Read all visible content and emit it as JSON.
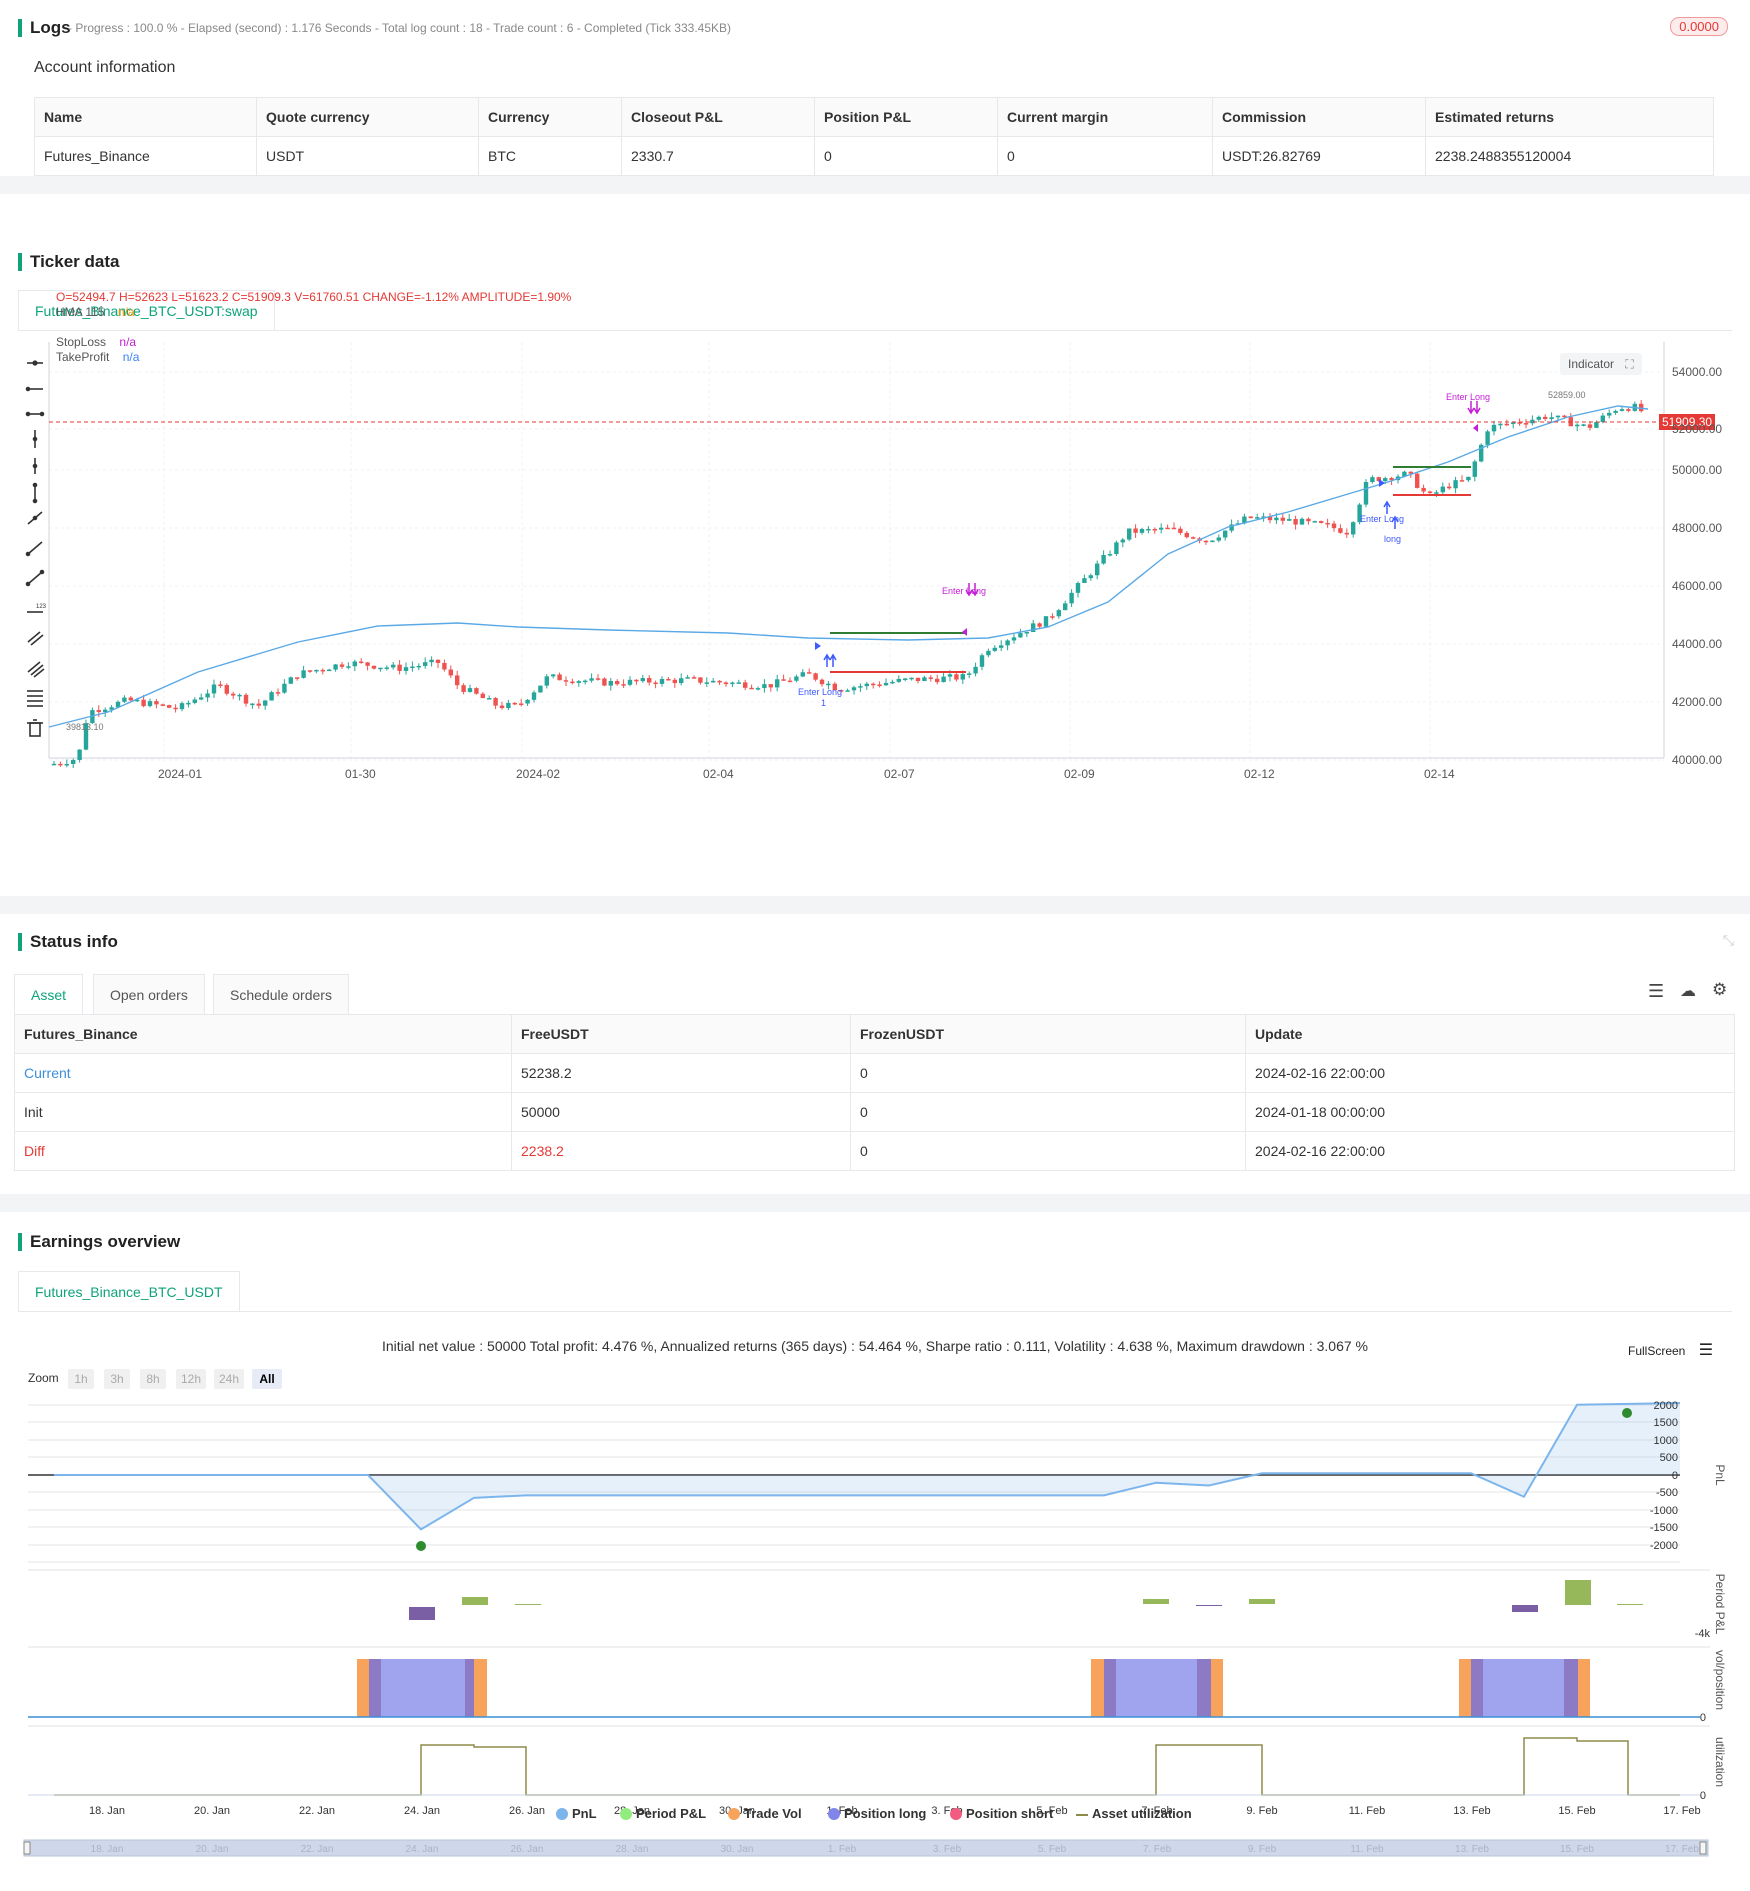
{
  "logs": {
    "title": "Logs",
    "progress_text": "- Progress : 100.0 % - Elapsed (second) : 1.176  Seconds - Total log count : 18 - Trade count : 6 - Completed (Tick 333.45KB)",
    "badge": "0.0000"
  },
  "account": {
    "title": "Account information",
    "headers": [
      "Name",
      "Quote currency",
      "Currency",
      "Closeout P&L",
      "Position P&L",
      "Current margin",
      "Commission",
      "Estimated returns"
    ],
    "row": [
      "Futures_Binance",
      "USDT",
      "BTC",
      "2330.7",
      "0",
      "0",
      "USDT:26.82769",
      "2238.2488355120004"
    ]
  },
  "ticker": {
    "title": "Ticker data",
    "tab": "Futures_Binance_BTC_USDT:swap",
    "ohlc_label": "O=52494.7 H=52623 L=51623.2 C=51909.3 V=61760.51 CHANGE=-1.12% AMPLITUDE=1.90%",
    "hma_label": "HMA 115",
    "hma_value": "n/a",
    "stoploss_label": "StopLoss",
    "stoploss_value": "n/a",
    "takeprofit_label": "TakeProfit",
    "takeprofit_value": "n/a",
    "indicator_button": "Indicator",
    "last_price": "51909.30",
    "high_label": "52859.00",
    "low_label": "39813.10",
    "enter_long_1": "Enter Long",
    "enter_long_2": "Enter Long",
    "enter_long_3": "Enter Long",
    "exit_1": "Enter Long",
    "exit_2": "Enter Long",
    "long_label": "long",
    "one_label": "1",
    "y_ticks": [
      "54000.00",
      "52000.00",
      "50000.00",
      "48000.00",
      "46000.00",
      "44000.00",
      "42000.00",
      "40000.00"
    ],
    "x_ticks": [
      "2024-01",
      "01-30",
      "2024-02",
      "02-04",
      "02-07",
      "02-09",
      "02-12",
      "02-14"
    ],
    "colors": {
      "up": "#26a69a",
      "down": "#ef5350",
      "hma": "#5aa9e6",
      "tp": "#2e7d32",
      "sl": "#e53935"
    }
  },
  "status": {
    "title": "Status info",
    "tabs": [
      "Asset",
      "Open orders",
      "Schedule orders"
    ],
    "headers": [
      "Futures_Binance",
      "FreeUSDT",
      "FrozenUSDT",
      "Update"
    ],
    "rows": [
      [
        "Current",
        "52238.2",
        "0",
        "2024-02-16 22:00:00"
      ],
      [
        "Init",
        "50000",
        "0",
        "2024-01-18 00:00:00"
      ],
      [
        "Diff",
        "2238.2",
        "0",
        "2024-02-16 22:00:00"
      ]
    ]
  },
  "earnings": {
    "title": "Earnings overview",
    "tab": "Futures_Binance_BTC_USDT",
    "summary": "Initial net value : 50000 Total profit: 4.476 %, Annualized returns (365 days) : 54.464 %, Sharpe ratio : 0.111, Volatility : 4.638 %, Maximum drawdown : 3.067 %",
    "fullscreen": "FullScreen",
    "zoom_label": "Zoom",
    "zoom_buttons": [
      "1h",
      "3h",
      "8h",
      "12h",
      "24h",
      "All"
    ],
    "pnl_ticks": [
      "2000",
      "1500",
      "1000",
      "500",
      "0",
      "-500",
      "-1000",
      "-1500",
      "-2000"
    ],
    "axis_labels": [
      "PnL",
      "Period P&L",
      "vol/position",
      "utilization"
    ],
    "period_tick": "-4k",
    "zero": "0",
    "x_ticks": [
      "18. Jan",
      "20. Jan",
      "22. Jan",
      "24. Jan",
      "26. Jan",
      "28. Jan",
      "30. Jan",
      "1. Feb",
      "3. Feb",
      "5. Feb",
      "7. Feb",
      "9. Feb",
      "11. Feb",
      "13. Feb",
      "15. Feb",
      "17. Feb"
    ],
    "legend": [
      {
        "name": "PnL",
        "color": "#7cb5ec"
      },
      {
        "name": "Period P&L",
        "color": "#90ed7d"
      },
      {
        "name": "Trade Vol",
        "color": "#f7a35c"
      },
      {
        "name": "Position long",
        "color": "#8085e9"
      },
      {
        "name": "Position short",
        "color": "#f15c80"
      },
      {
        "name": "Asset utilization",
        "color": "#8d8b4a"
      }
    ]
  },
  "chart_data": [
    {
      "type": "line",
      "title": "",
      "x": [
        "18. Jan",
        "23. Jan",
        "24. Jan",
        "25. Jan",
        "26. Jan",
        "6. Feb",
        "7. Feb",
        "8. Feb",
        "9. Feb",
        "13. Feb",
        "14. Feb",
        "15. Feb",
        "17. Feb"
      ],
      "series": [
        {
          "name": "PnL",
          "values": [
            0,
            0,
            -1550,
            -650,
            -580,
            -580,
            -220,
            -300,
            50,
            50,
            -620,
            2000,
            2050
          ]
        }
      ],
      "ylim": [
        -2000,
        2000
      ]
    }
  ]
}
